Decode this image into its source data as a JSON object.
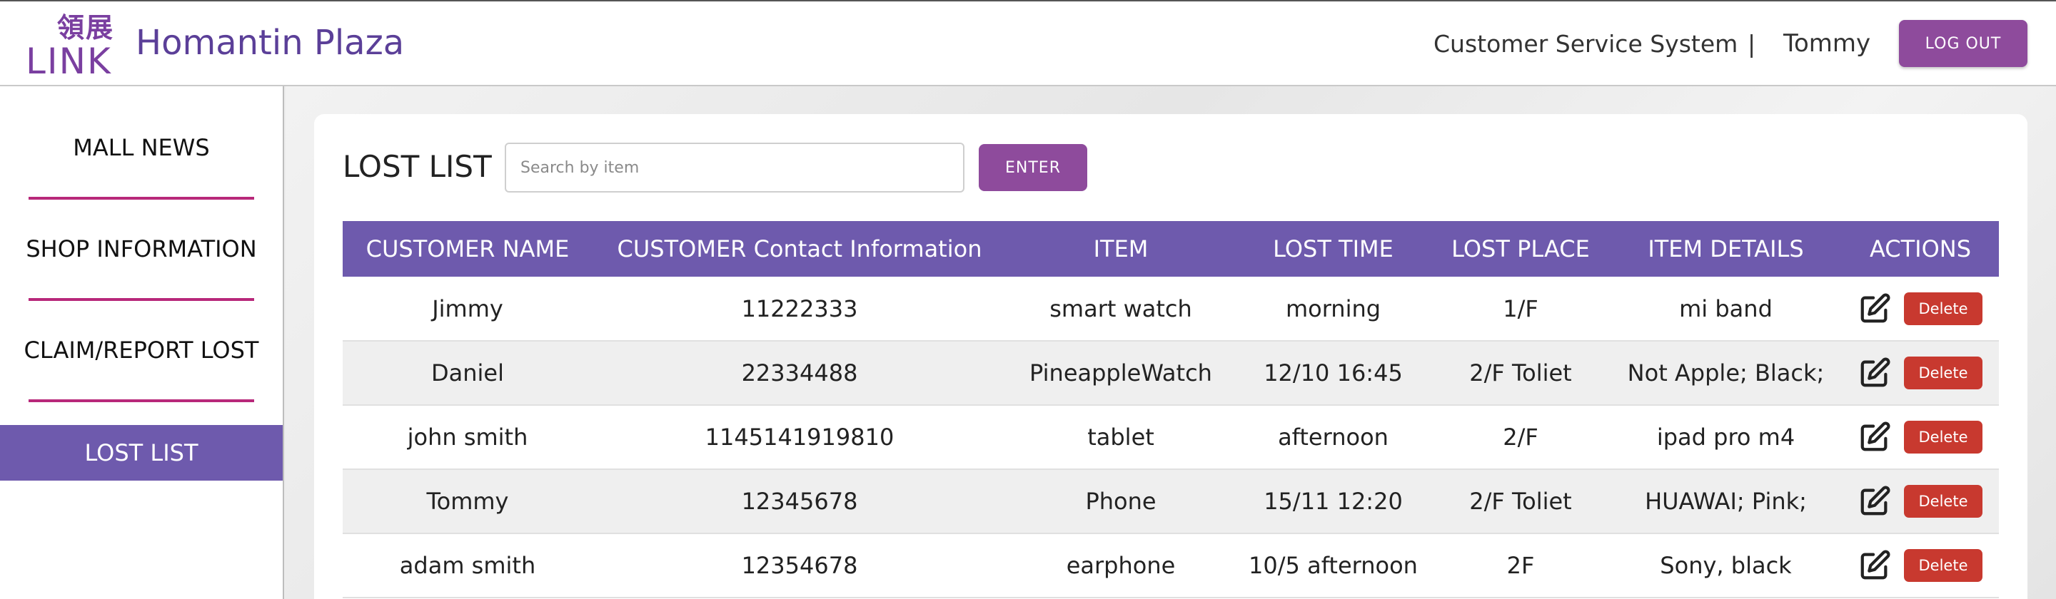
{
  "header": {
    "logo_cjk": "領展",
    "logo_word": "LINK",
    "title": "Homantin Plaza",
    "system_name": "Customer Service System",
    "separator": "|",
    "user": "Tommy",
    "logout_label": "LOG OUT"
  },
  "sidebar": {
    "items": [
      {
        "label": "MALL NEWS"
      },
      {
        "label": "SHOP INFORMATION"
      },
      {
        "label": "CLAIM/REPORT LOST"
      },
      {
        "label": "LOST LIST",
        "active": true
      }
    ]
  },
  "main": {
    "title": "LOST LIST",
    "search_placeholder": "Search by item",
    "enter_label": "ENTER",
    "columns": [
      "CUSTOMER NAME",
      "CUSTOMER Contact Information",
      "ITEM",
      "LOST TIME",
      "LOST PLACE",
      "ITEM DETAILS",
      "ACTIONS"
    ],
    "delete_label": "Delete",
    "rows": [
      {
        "name": "Jimmy",
        "contact": "11222333",
        "item": "smart watch",
        "time": "morning",
        "place": "1/F",
        "details": "mi band"
      },
      {
        "name": "Daniel",
        "contact": "22334488",
        "item": "PineappleWatch",
        "time": "12/10 16:45",
        "place": "2/F Toliet",
        "details": "Not Apple; Black;"
      },
      {
        "name": "john smith",
        "contact": "1145141919810",
        "item": "tablet",
        "time": "afternoon",
        "place": "2/F",
        "details": "ipad pro m4"
      },
      {
        "name": "Tommy",
        "contact": "12345678",
        "item": "Phone",
        "time": "15/11 12:20",
        "place": "2/F Toliet",
        "details": "HUAWAI; Pink;"
      },
      {
        "name": "adam smith",
        "contact": "12354678",
        "item": "earphone",
        "time": "10/5 afternoon",
        "place": "2F",
        "details": "Sony, black"
      }
    ]
  },
  "colors": {
    "brand_purple": "#6e5aad",
    "button_purple": "#8e4b9c",
    "divider_magenta": "#b8287a",
    "delete_red": "#c8392f"
  }
}
